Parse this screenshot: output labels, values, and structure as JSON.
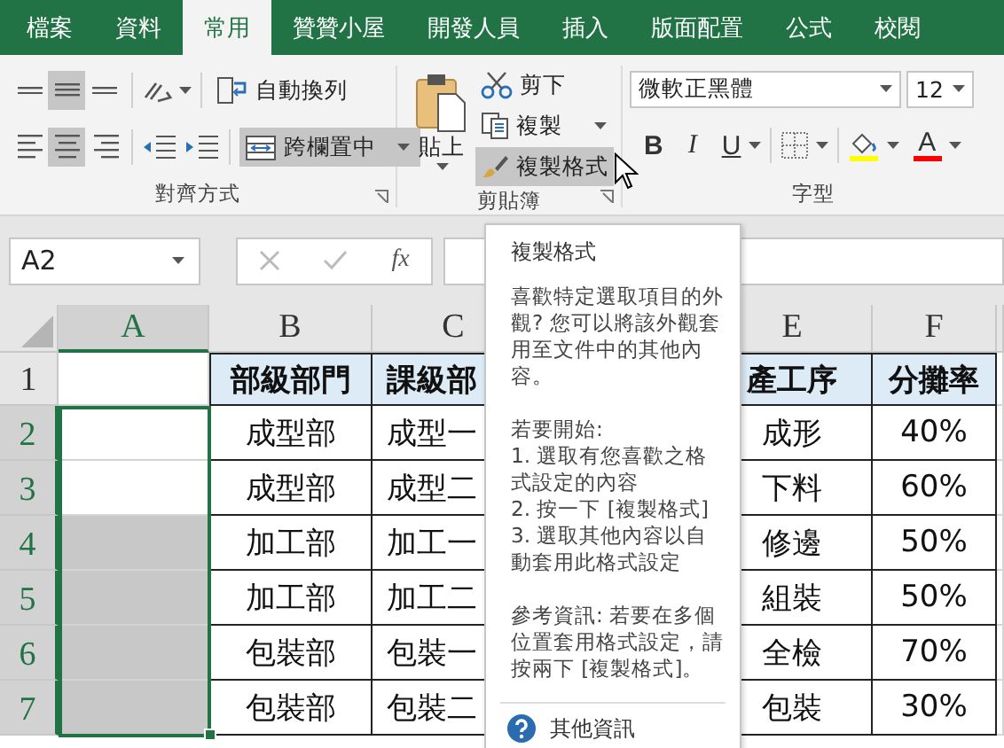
{
  "ribbon_tabs": [
    {
      "label": "檔案",
      "selected": false
    },
    {
      "label": "資料",
      "selected": false
    },
    {
      "label": "常用",
      "selected": true
    },
    {
      "label": "贊贊小屋",
      "selected": false
    },
    {
      "label": "開發人員",
      "selected": false
    },
    {
      "label": "插入",
      "selected": false
    },
    {
      "label": "版面配置",
      "selected": false
    },
    {
      "label": "公式",
      "selected": false
    },
    {
      "label": "校閱",
      "selected": false
    }
  ],
  "alignment_group": {
    "label": "對齊方式",
    "vertical_align": [
      {
        "kind": "top",
        "selected": false
      },
      {
        "kind": "middle",
        "selected": true
      },
      {
        "kind": "bottom",
        "selected": false
      }
    ],
    "horizontal_align": [
      {
        "kind": "left",
        "selected": false
      },
      {
        "kind": "center",
        "selected": true
      },
      {
        "kind": "right",
        "selected": false
      }
    ],
    "wrap_text": {
      "label": "自動換列",
      "selected": false
    },
    "merge_center": {
      "label": "跨欄置中",
      "selected": true
    }
  },
  "clipboard_group": {
    "label": "剪貼簿",
    "paste": "貼上",
    "cut": "剪下",
    "copy": "複製",
    "format_painter": {
      "label": "複製格式",
      "selected": true
    }
  },
  "font_group": {
    "label": "字型",
    "font_name": "微軟正黑體",
    "font_size": "12",
    "bold": "B",
    "italic": "I",
    "underline": "U",
    "font_color": "A"
  },
  "name_box": "A2",
  "formula_bar": {
    "function_label": "fx"
  },
  "sheet": {
    "columns": [
      {
        "label": "A",
        "selected": true
      },
      {
        "label": "B",
        "selected": false
      },
      {
        "label": "C",
        "selected": false
      },
      {
        "label": "E",
        "selected": false
      },
      {
        "label": "F",
        "selected": false
      }
    ],
    "header_row": {
      "number": "1",
      "selected": false,
      "column_b": "部級部門",
      "column_c": "課級部",
      "column_e": "產工序",
      "column_f": "分攤率"
    },
    "rows": [
      {
        "number": "2",
        "selected": true,
        "a_shaded": false,
        "column_b": "成型部",
        "column_c": "成型一",
        "column_e": "成形",
        "column_f": "40%"
      },
      {
        "number": "3",
        "selected": true,
        "a_shaded": false,
        "column_b": "成型部",
        "column_c": "成型二",
        "column_e": "下料",
        "column_f": "60%"
      },
      {
        "number": "4",
        "selected": true,
        "a_shaded": true,
        "column_b": "加工部",
        "column_c": "加工一",
        "column_e": "修邊",
        "column_f": "50%"
      },
      {
        "number": "5",
        "selected": true,
        "a_shaded": true,
        "column_b": "加工部",
        "column_c": "加工二",
        "column_e": "組裝",
        "column_f": "50%"
      },
      {
        "number": "6",
        "selected": true,
        "a_shaded": true,
        "column_b": "包裝部",
        "column_c": "包裝一",
        "column_e": "全檢",
        "column_f": "70%"
      },
      {
        "number": "7",
        "selected": true,
        "a_shaded": true,
        "column_b": "包裝部",
        "column_c": "包裝二",
        "column_e": "包裝",
        "column_f": "30%"
      }
    ]
  },
  "tooltip": {
    "title": "複製格式",
    "description": "喜歡特定選取項目的外觀? 您可以將該外觀套用至文件中的其他內容。",
    "steps_intro": "若要開始:",
    "steps": [
      "1. 選取有您喜歡之格式設定的內容",
      "2. 按一下 [複製格式]",
      "3. 選取其他內容以自動套用此格式設定"
    ],
    "tip": "參考資訊: 若要在多個位置套用格式設定，請按兩下 [複製格式]。",
    "more_info": "其他資訊"
  }
}
